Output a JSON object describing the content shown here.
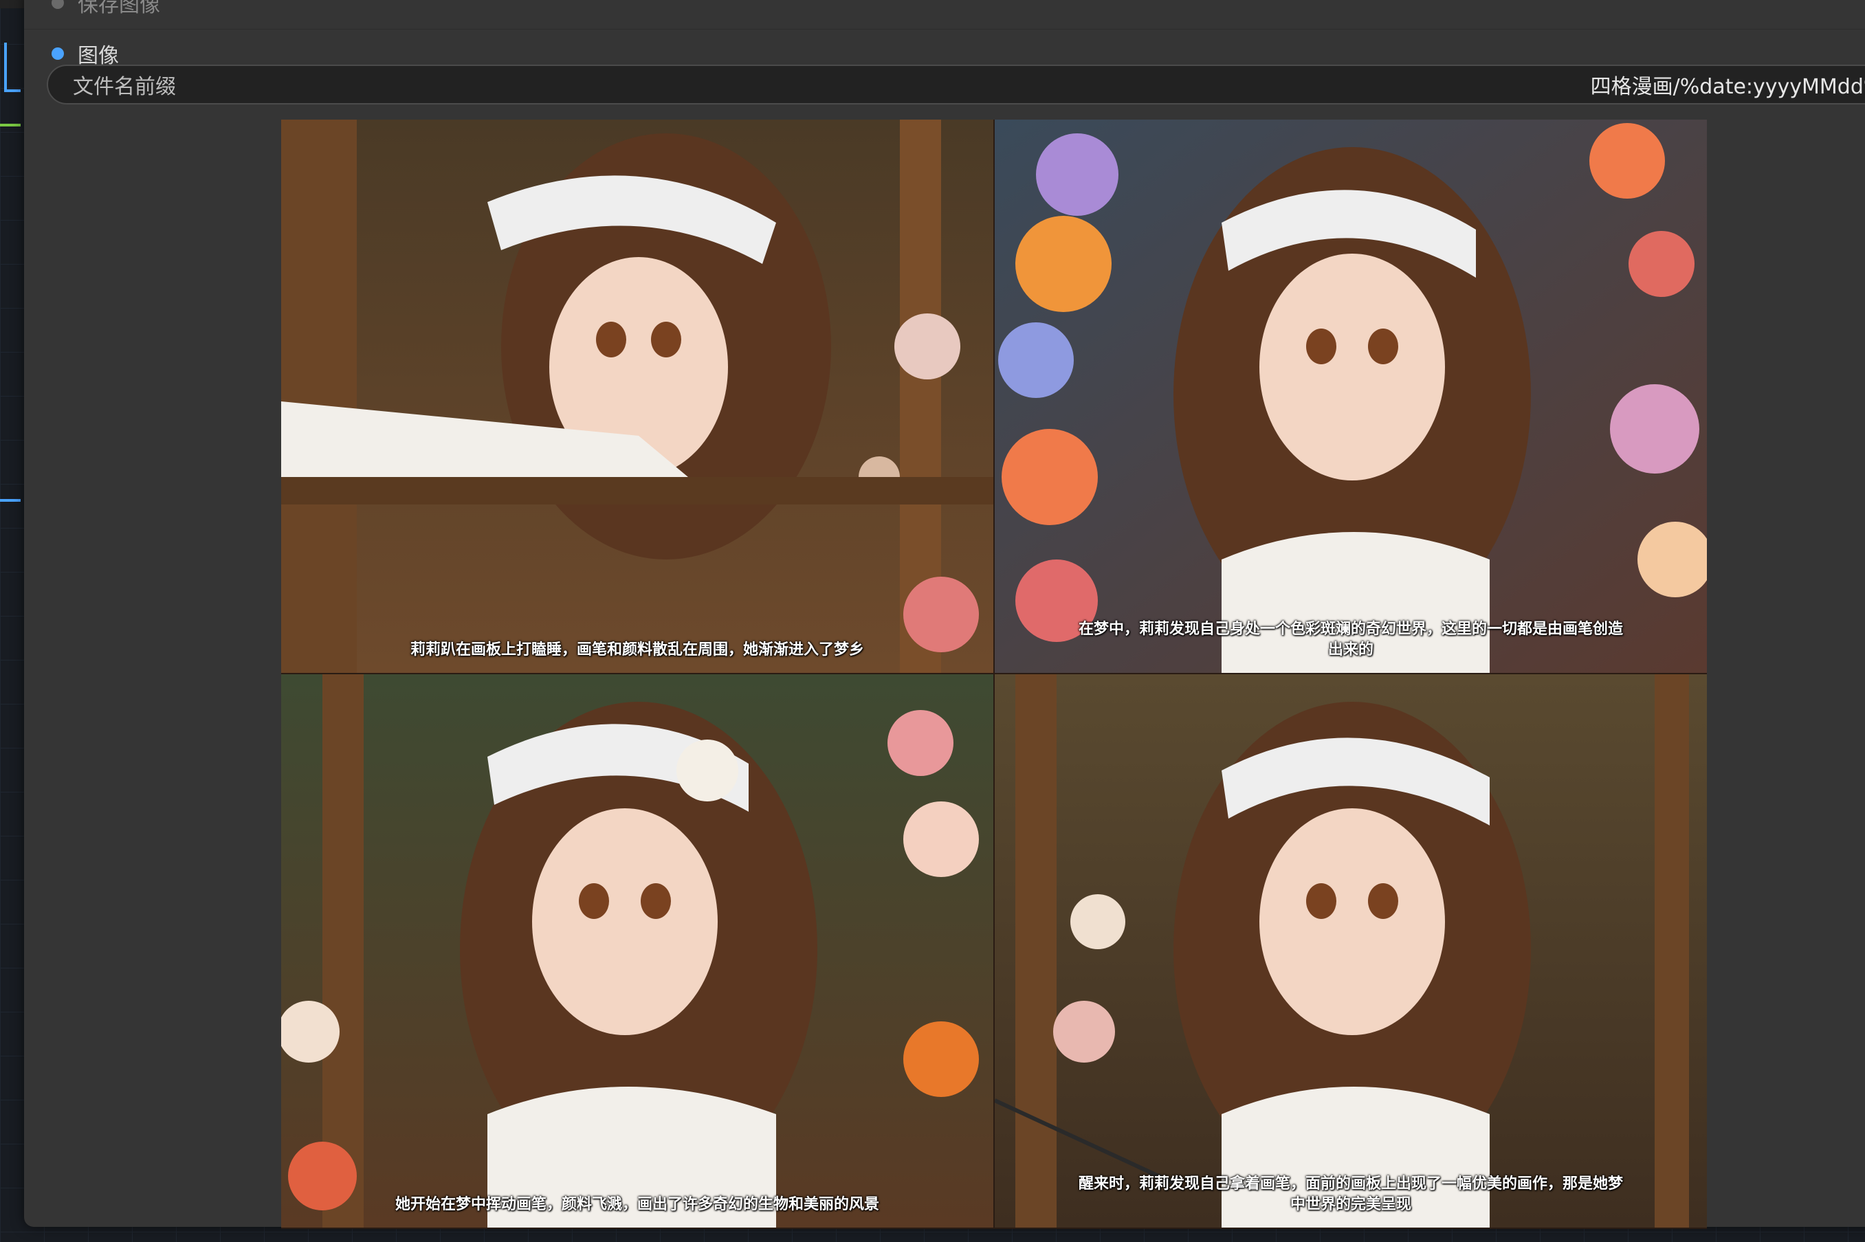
{
  "node": {
    "save_image_label": "保存图像",
    "image_output_label": "图像",
    "filename_prefix": {
      "label": "文件名前缀",
      "value": "四格漫画/%date:yyyyMMdd%/c"
    }
  },
  "comic": {
    "panels": [
      {
        "caption": "莉莉趴在画板上打瞌睡，画笔和颜料散乱在周围，她渐渐进入了梦乡",
        "bg_top": "#4a3a26",
        "bg_bottom": "#6e4a2c"
      },
      {
        "caption": "在梦中，莉莉发现自己身处一个色彩斑斓的奇幻世界，这里的一切都是由画笔创造出来的",
        "bg_top": "#3a4a5a",
        "bg_bottom": "#5a3a30"
      },
      {
        "caption": "她开始在梦中挥动画笔，颜料飞溅，画出了许多奇幻的生物和美丽的风景",
        "bg_top": "#3e4a32",
        "bg_bottom": "#5a3a24"
      },
      {
        "caption": "醒来时，莉莉发现自己拿着画笔，面前的画板上出现了一幅优美的画作，那是她梦中世界的完美呈现",
        "bg_top": "#5a4a30",
        "bg_bottom": "#3e2e20"
      }
    ]
  }
}
